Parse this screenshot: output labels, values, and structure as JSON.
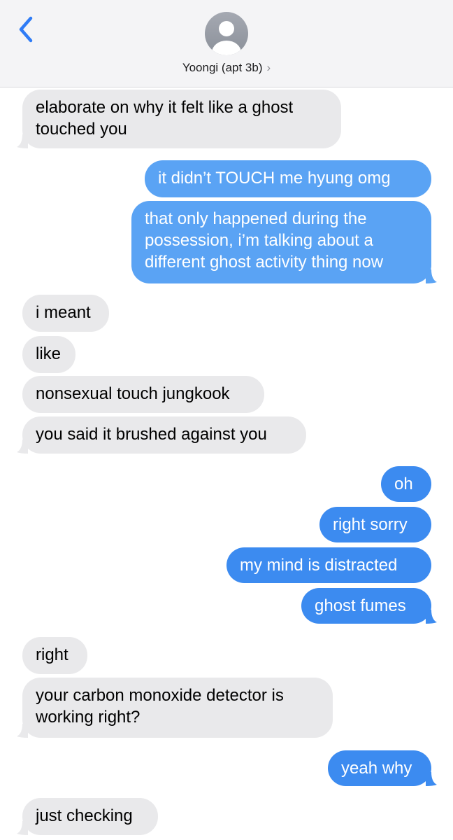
{
  "header": {
    "contact_name": "Yoongi (apt 3b)",
    "back_icon": "chevron-left-icon",
    "avatar_icon": "person-silhouette-icon",
    "detail_icon": "chevron-right-icon"
  },
  "colors": {
    "sent_bubble": "#3c8bf0",
    "sent_bubble_light": "#5aa3f4",
    "received_bubble": "#e9e9eb",
    "header_bg": "#f4f4f6",
    "accent": "#2f7cf6"
  },
  "messages": [
    {
      "from": "contact",
      "text": "elaborate on why it felt like a ghost\ntouched you"
    },
    {
      "from": "me",
      "text": "it didn’t TOUCH me hyung omg"
    },
    {
      "from": "me",
      "text": "that only happened during the\npossession, i’m talking about a\ndifferent ghost activity thing now"
    },
    {
      "from": "contact",
      "text": "i meant"
    },
    {
      "from": "contact",
      "text": "like"
    },
    {
      "from": "contact",
      "text": "nonsexual touch jungkook"
    },
    {
      "from": "contact",
      "text": "you said it brushed against you"
    },
    {
      "from": "me",
      "text": "oh"
    },
    {
      "from": "me",
      "text": "right sorry"
    },
    {
      "from": "me",
      "text": "my mind is distracted"
    },
    {
      "from": "me",
      "text": "ghost fumes"
    },
    {
      "from": "contact",
      "text": "right"
    },
    {
      "from": "contact",
      "text": "your carbon monoxide detector is\nworking right?"
    },
    {
      "from": "me",
      "text": "yeah why"
    },
    {
      "from": "contact",
      "text": "just checking"
    }
  ]
}
